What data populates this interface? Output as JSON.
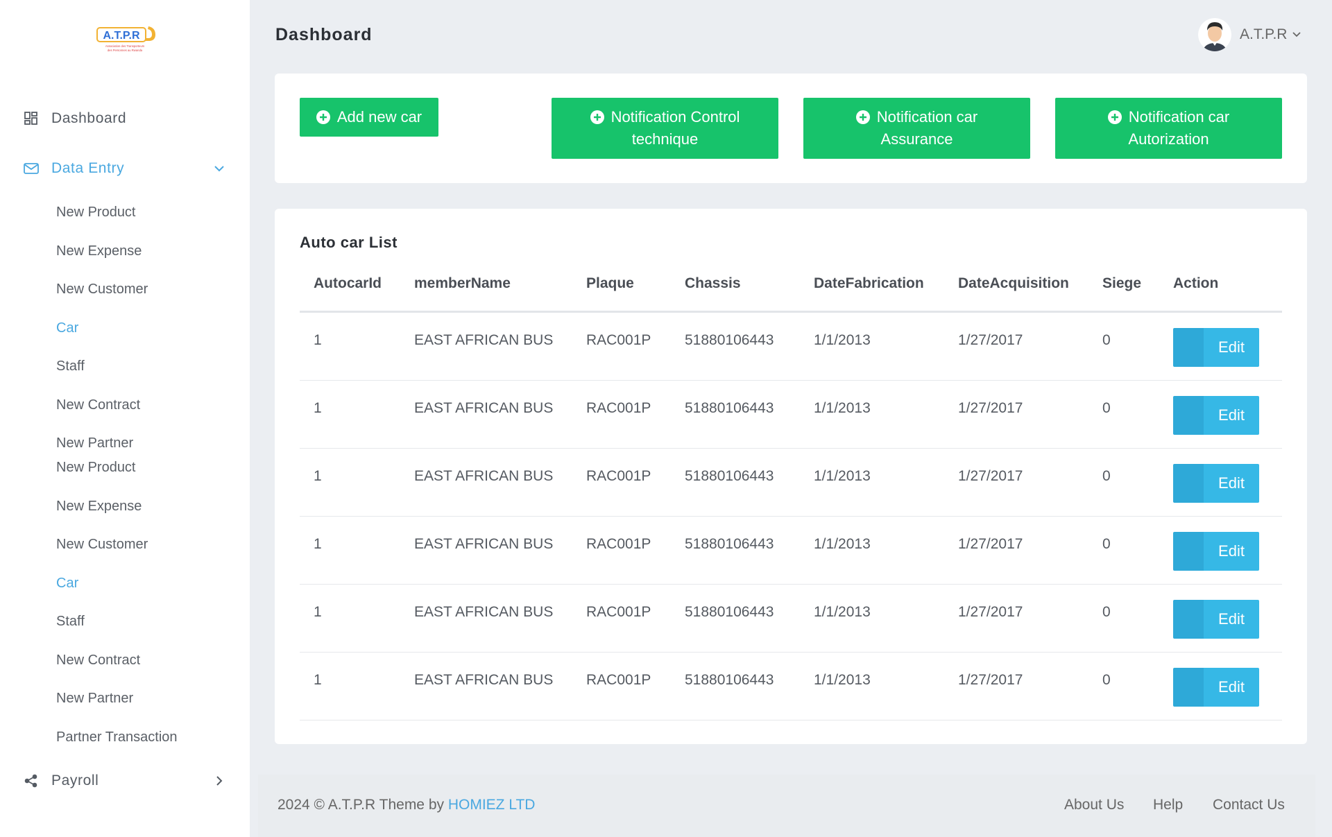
{
  "app": {
    "logo_text": "A.T.P.R",
    "logo_subtitle": "Association des Transporteurs des Personnes au Rwanda"
  },
  "header": {
    "title": "Dashboard",
    "user_name": "A.T.P.R"
  },
  "sidebar": {
    "dashboard_label": "Dashboard",
    "data_entry_label": "Data Entry",
    "payroll_label": "Payroll",
    "sub_items": [
      "New Product",
      "New Expense",
      "New Customer",
      "Car",
      "Staff",
      "New Contract",
      "New Partner",
      "New Product",
      "New Expense",
      "New Customer",
      "Car",
      "Staff",
      "New Contract",
      "New Partner",
      "Partner Transaction"
    ]
  },
  "actions": {
    "add_car": "Add new car",
    "notif_control_line1": "Notification Control",
    "notif_control_line2": "technique",
    "notif_assurance_line1": "Notification car",
    "notif_assurance_line2": "Assurance",
    "notif_autorization_line1": "Notification car",
    "notif_autorization_line2": "Autorization"
  },
  "car_list": {
    "title": "Auto car List",
    "columns": [
      "AutocarId",
      "memberName",
      "Plaque",
      "Chassis",
      "DateFabrication",
      "DateAcquisition",
      "Siege",
      "Action"
    ],
    "edit_label": "Edit",
    "rows": [
      [
        "1",
        "EAST AFRICAN BUS",
        "RAC001P",
        "51880106443",
        "1/1/2013",
        "1/27/2017",
        "0"
      ],
      [
        "1",
        "EAST AFRICAN BUS",
        "RAC001P",
        "51880106443",
        "1/1/2013",
        "1/27/2017",
        "0"
      ],
      [
        "1",
        "EAST AFRICAN BUS",
        "RAC001P",
        "51880106443",
        "1/1/2013",
        "1/27/2017",
        "0"
      ],
      [
        "1",
        "EAST AFRICAN BUS",
        "RAC001P",
        "51880106443",
        "1/1/2013",
        "1/27/2017",
        "0"
      ],
      [
        "1",
        "EAST AFRICAN BUS",
        "RAC001P",
        "51880106443",
        "1/1/2013",
        "1/27/2017",
        "0"
      ],
      [
        "1",
        "EAST AFRICAN BUS",
        "RAC001P",
        "51880106443",
        "1/1/2013",
        "1/27/2017",
        "0"
      ]
    ]
  },
  "footer": {
    "copyright": "2024 © A.T.P.R Theme by ",
    "brand_link": "HOMIEZ LTD",
    "links": [
      "About Us",
      "Help",
      "Contact Us"
    ]
  },
  "colors": {
    "accent": "#4aa8e0",
    "green": "#17c36b",
    "edit_blue": "#36b8e6"
  }
}
